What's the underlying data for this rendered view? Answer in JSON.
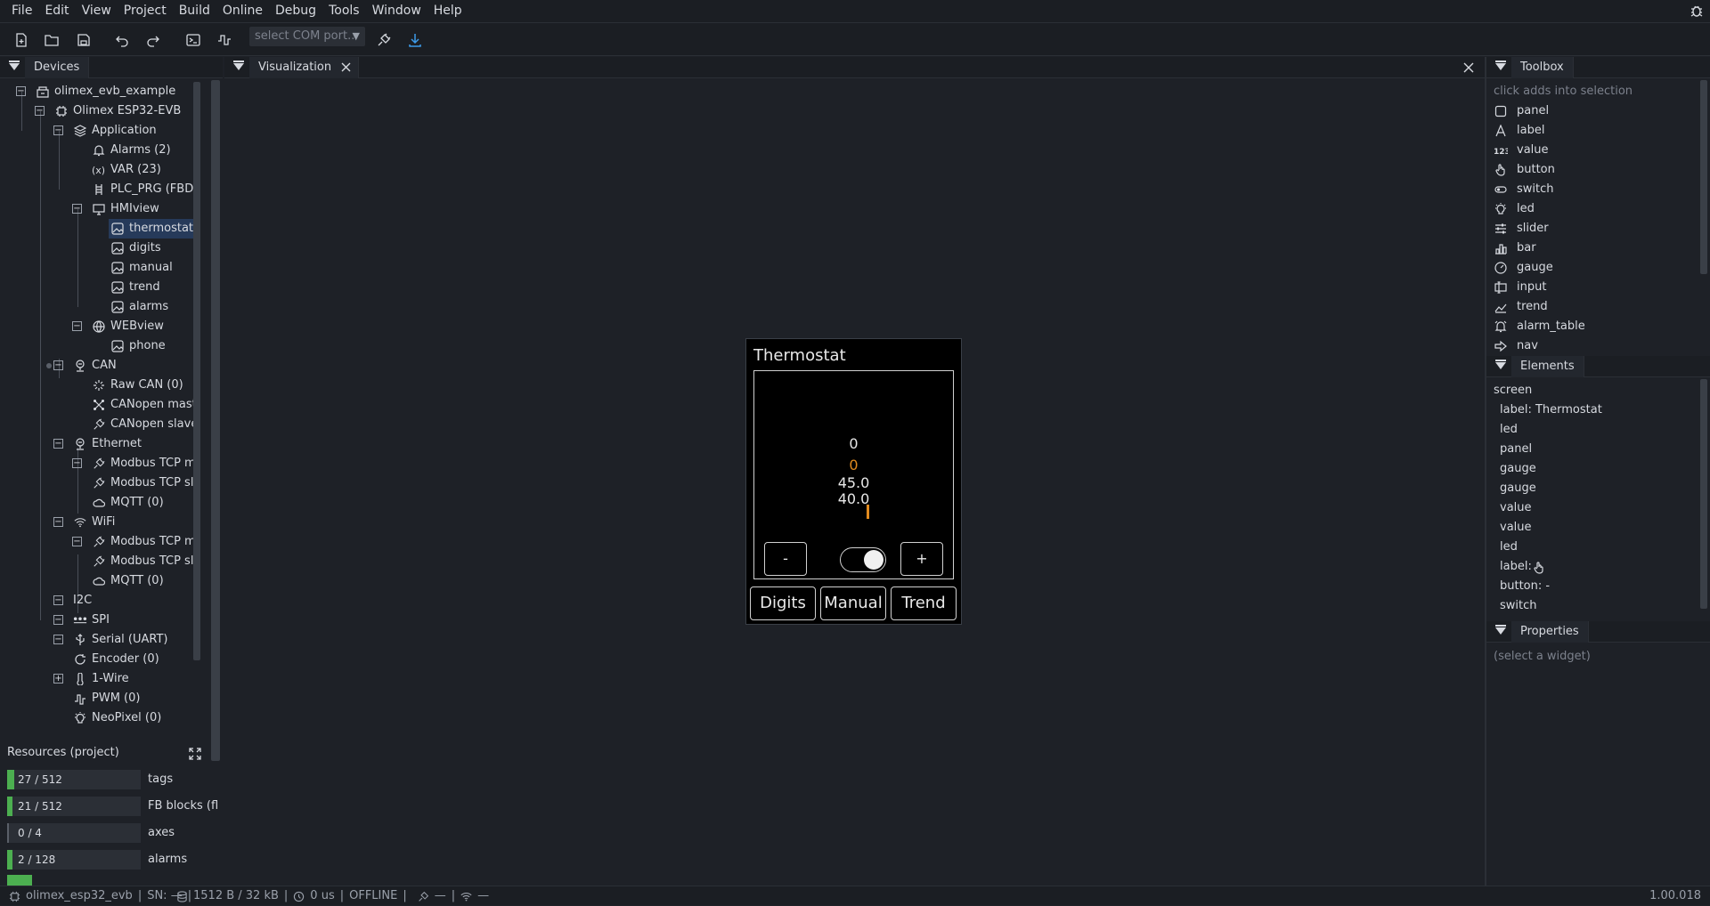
{
  "menu": [
    "File",
    "Edit",
    "View",
    "Project",
    "Build",
    "Online",
    "Debug",
    "Tools",
    "Window",
    "Help"
  ],
  "toolbar": {
    "com_placeholder": "select COM port..",
    "arrow": "▼"
  },
  "devices_panel": {
    "tab": "Devices"
  },
  "tree": [
    {
      "label": "olimex_evb_example",
      "icon": "project-icon"
    },
    {
      "label": "Olimex ESP32-EVB",
      "icon": "chip-icon"
    },
    {
      "label": "Application",
      "icon": "layers-icon"
    },
    {
      "label": "Alarms (2)",
      "icon": "bell-icon"
    },
    {
      "label": "VAR (23)",
      "icon": "variable-icon"
    },
    {
      "label": "PLC_PRG (FBD, :",
      "icon": "ladder-icon"
    },
    {
      "label": "HMIview",
      "icon": "monitor-icon"
    },
    {
      "label": "thermostat",
      "icon": "image-icon"
    },
    {
      "label": "digits",
      "icon": "image-icon"
    },
    {
      "label": "manual",
      "icon": "image-icon"
    },
    {
      "label": "trend",
      "icon": "image-icon"
    },
    {
      "label": "alarms",
      "icon": "image-icon"
    },
    {
      "label": "WEBview",
      "icon": "globe-icon"
    },
    {
      "label": "phone",
      "icon": "image-icon"
    },
    {
      "label": "CAN",
      "icon": "network-icon"
    },
    {
      "label": "Raw CAN (0)",
      "icon": "raw-can-icon"
    },
    {
      "label": "CANopen maste",
      "icon": "canopen-icon"
    },
    {
      "label": "CANopen slave",
      "icon": "plug-icon"
    },
    {
      "label": "Ethernet",
      "icon": "network-icon"
    },
    {
      "label": "Modbus TCP ma",
      "icon": "plug-icon"
    },
    {
      "label": "Modbus TCP sla",
      "icon": "plug-icon"
    },
    {
      "label": "MQTT (0)",
      "icon": "cloud-icon"
    },
    {
      "label": "WiFi",
      "icon": "wifi-icon"
    },
    {
      "label": "Modbus TCP ma",
      "icon": "plug-icon"
    },
    {
      "label": "Modbus TCP sla",
      "icon": "plug-icon"
    },
    {
      "label": "MQTT (0)",
      "icon": "cloud-icon"
    },
    {
      "label": "I2C",
      "icon": ""
    },
    {
      "label": "SPI",
      "icon": "spi-icon"
    },
    {
      "label": "Serial (UART)",
      "icon": "usb-icon"
    },
    {
      "label": "Encoder (0)",
      "icon": "encoder-icon"
    },
    {
      "label": "1-Wire",
      "icon": "thermometer-icon"
    },
    {
      "label": "PWM (0)",
      "icon": "pwm-icon"
    },
    {
      "label": "NeoPixel (0)",
      "icon": "bulb-icon"
    }
  ],
  "resources": {
    "title": "Resources (project)",
    "rows": [
      {
        "text": "27 / 512",
        "label": "tags",
        "fraction": 0.053
      },
      {
        "text": "21 / 512",
        "label": "FB blocks (fl",
        "fraction": 0.041
      },
      {
        "text": "0 / 4",
        "label": "axes",
        "fraction": 0
      },
      {
        "text": "2 / 128",
        "label": "alarms",
        "fraction": 0.016
      }
    ]
  },
  "visualization": {
    "tab": "Visualization"
  },
  "thermostat": {
    "title": "Thermostat",
    "value1": "0",
    "value2": "0",
    "value3": "45.0",
    "value4": "40.0",
    "minus": "-",
    "plus": "+",
    "nav": [
      "Digits",
      "Manual",
      "Trend"
    ],
    "accent": "#e08a1e"
  },
  "toolbox": {
    "tab": "Toolbox",
    "hint": "click adds into selection",
    "items": [
      "panel",
      "label",
      "value",
      "button",
      "switch",
      "led",
      "slider",
      "bar",
      "gauge",
      "input",
      "trend",
      "alarm_table",
      "nav"
    ]
  },
  "elements": {
    "tab": "Elements",
    "items": [
      "screen",
      "label: Thermostat",
      "led",
      "panel",
      "gauge",
      "gauge",
      "value",
      "value",
      "led",
      "label:",
      "button: -",
      "switch"
    ]
  },
  "properties": {
    "tab": "Properties",
    "hint": "(select a widget)"
  },
  "status": {
    "device": "olimex_esp32_evb",
    "sn": "SN: —",
    "memory": "1512 B / 32 kB",
    "cycle": "0 us",
    "state": "OFFLINE",
    "link1": "—",
    "link2": "—",
    "version": "1.00.018"
  }
}
